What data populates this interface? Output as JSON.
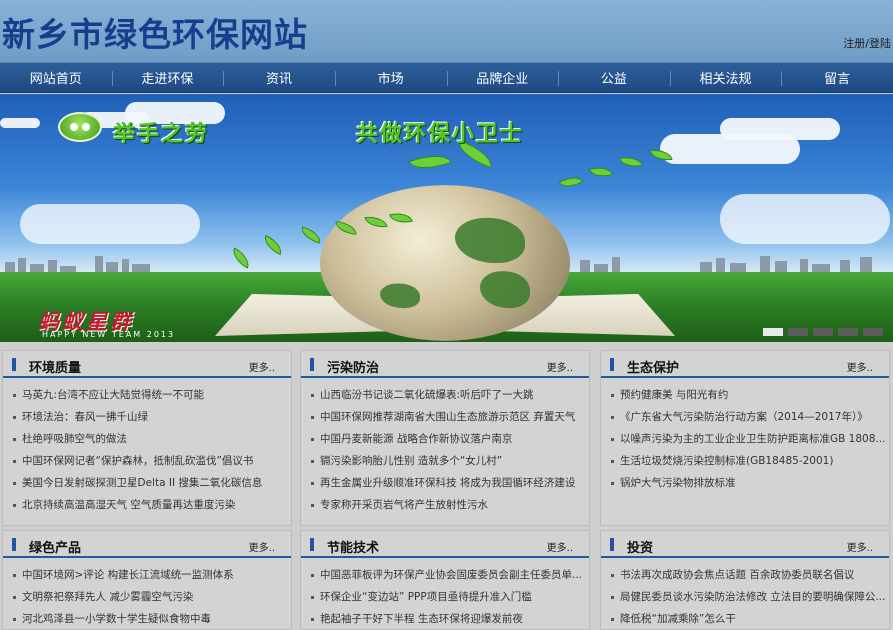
{
  "header": {
    "site_title": "新乡市绿色环保网站",
    "login_link": "注册/登陆"
  },
  "nav": {
    "items": [
      "网站首页",
      "走进环保",
      "资讯",
      "市场",
      "品牌企业",
      "公益",
      "相关法规",
      "留言"
    ]
  },
  "banner": {
    "slogan_left": "举手之劳",
    "slogan_right": "共做环保小卫士",
    "team_logo": "蚂蚁星群",
    "team_sub": "HAPPY NEW TEAM 2013",
    "slide_count": 5,
    "active_slide": 1
  },
  "panels": [
    {
      "title": "环境质量",
      "more": "更多..",
      "items": [
        "马英九:台湾不应让大陆觉得统一不可能",
        "环境法治：春风一拂千山绿",
        "杜绝呼吸肺空气的做法",
        "中国环保网记者“保护森林，抵制乱砍滥伐”倡议书",
        "美国今日发射碳探测卫星Delta II 搜集二氧化碳信息",
        "北京持续高温高湿天气 空气质量再达重度污染"
      ]
    },
    {
      "title": "污染防治",
      "more": "更多..",
      "items": [
        "山西临汾书记谈二氧化硫爆表:听后吓了一大跳",
        "中国环保网推荐湖南省大围山生态旅游示范区 弃置天气",
        "中国丹麦新能源 战略合作新协议落户南京",
        "镉污染影响胎儿性别 造就多个“女儿村”",
        "再生金属业升级顺准环保科技 将成为我国循环经济建设",
        "专家称开采页岩气将产生放射性污水"
      ]
    },
    {
      "title": "生态保护",
      "more": "更多..",
      "items": [
        "预约健康美 与阳光有约",
        "《广东省大气污染防治行动方案（2014—2017年）》",
        "以噪声污染为主的工业企业卫生防护距离标准GB 1808...",
        "生活垃圾焚烧污染控制标准(GB18485-2001)",
        "锅炉大气污染物排放标准"
      ]
    },
    {
      "title": "绿色产品",
      "more": "更多..",
      "items": [
        "中国环境网>评论 构建长江流域统一监测体系",
        "文明祭祀祭拜先人 减少雾霾空气污染",
        "河北鸡泽县一小学数十学生疑似食物中毒"
      ]
    },
    {
      "title": "节能技术",
      "more": "更多..",
      "items": [
        "中国恶菲板评为环保产业协会固废委员会副主任委员单...",
        "环保企业“变边站” PPP项目亟待提升准入门槛",
        "艳起袖子干好下半程 生态环保将迎爆发前夜"
      ]
    },
    {
      "title": "投资",
      "more": "更多..",
      "items": [
        "书法再次成政协会焦点话题 百余政协委员联名倡议",
        "局健民委员谈水污染防治法修改 立法目的要明确保障公...",
        "降低税“加减乘除”怎么干"
      ]
    }
  ]
}
